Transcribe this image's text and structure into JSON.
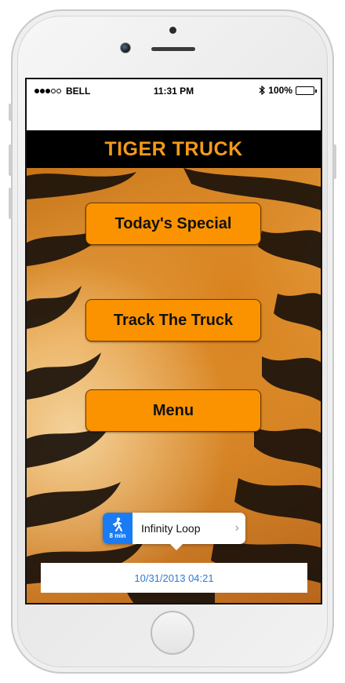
{
  "status_bar": {
    "carrier": "BELL",
    "time": "11:31 PM",
    "battery": "100%",
    "battery_level": 1.0,
    "signal_bars_filled": 3,
    "signal_bars_total": 5,
    "icons": [
      "signal-dots-icon",
      "bluetooth-icon",
      "battery-icon"
    ]
  },
  "header": {
    "title": "TIGER TRUCK",
    "title_color": "#f39a1a",
    "background": "#000000"
  },
  "buttons": [
    {
      "label": "Today's Special"
    },
    {
      "label": "Track The Truck"
    },
    {
      "label": "Menu"
    }
  ],
  "button_color": "#fb9300",
  "map_callout": {
    "walk_time": "8 min",
    "location": "Infinity Loop",
    "icons": [
      "walking-person-icon",
      "chevron-right-icon"
    ],
    "accent": "#1a7cf5"
  },
  "timestamp": "10/31/2013 04:21",
  "timestamp_color": "#2f7ad6"
}
